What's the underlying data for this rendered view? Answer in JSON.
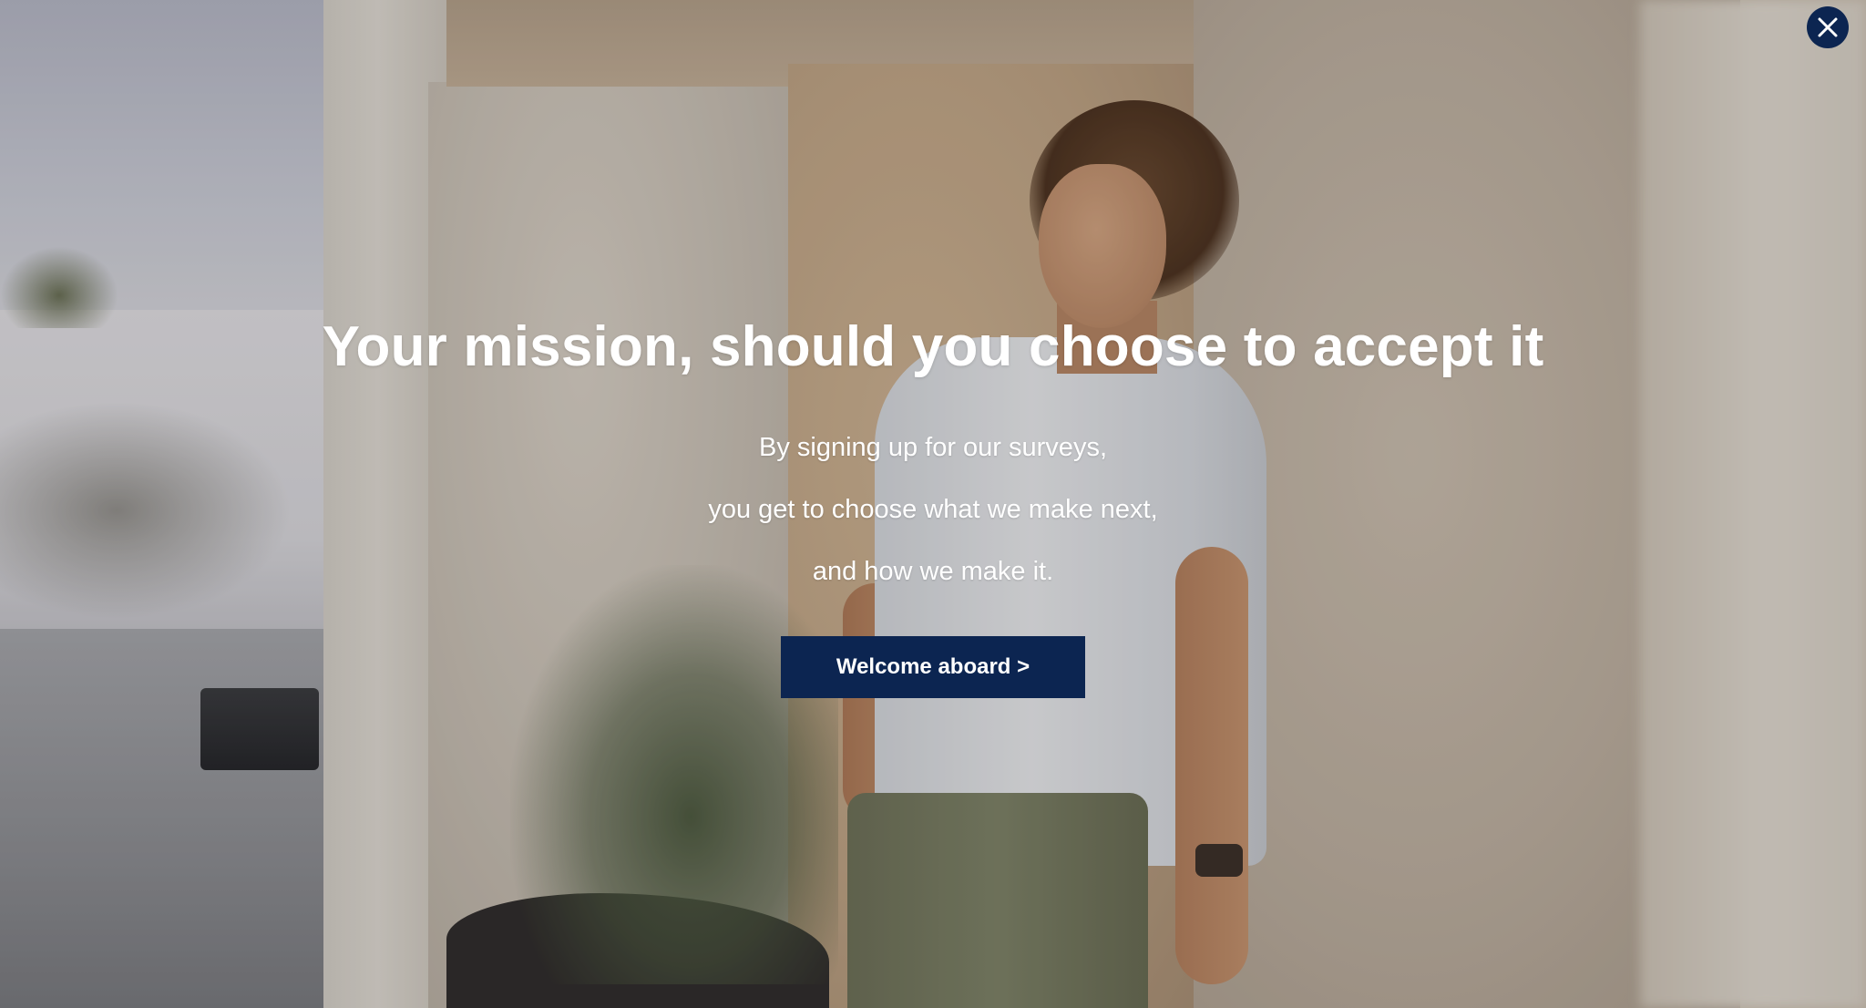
{
  "modal": {
    "headline": "Your mission, should you choose to accept it",
    "body_lines": [
      "By signing up for our surveys,",
      "you get to choose what we make next,",
      "and how we make it."
    ],
    "cta_label": "Welcome aboard >",
    "close_icon": "close-icon"
  },
  "colors": {
    "accent": "#0c2551",
    "text": "#ffffff"
  }
}
